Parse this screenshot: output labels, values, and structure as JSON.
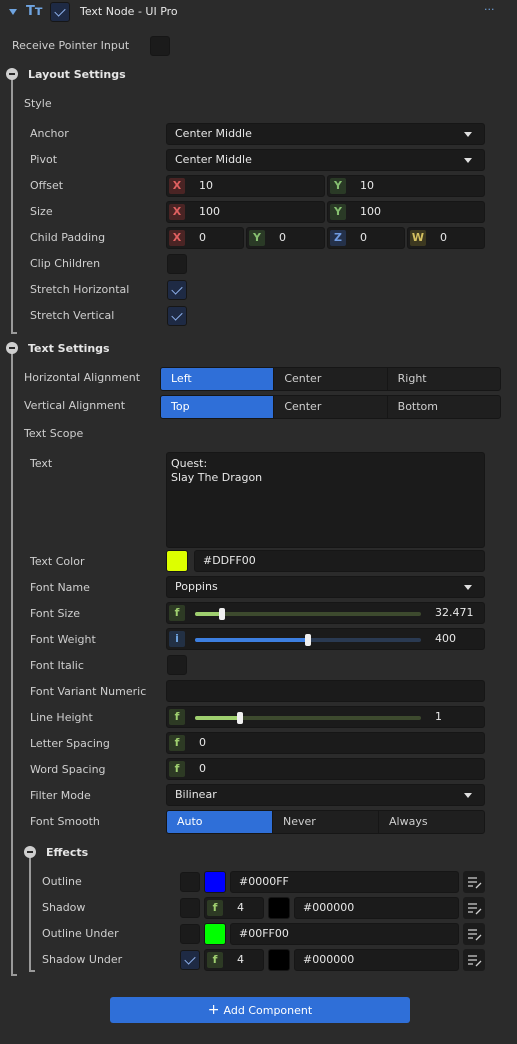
{
  "header": {
    "title": "Text Node - UI Pro",
    "menu": "···"
  },
  "receive_pointer_input": {
    "label": "Receive Pointer Input",
    "checked": false
  },
  "layout": {
    "title": "Layout Settings",
    "style_label": "Style",
    "anchor": {
      "label": "Anchor",
      "value": "Center Middle"
    },
    "pivot": {
      "label": "Pivot",
      "value": "Center Middle"
    },
    "offset": {
      "label": "Offset",
      "x_axis": "X",
      "x": "10",
      "y_axis": "Y",
      "y": "10"
    },
    "size": {
      "label": "Size",
      "x_axis": "X",
      "x": "100",
      "y_axis": "Y",
      "y": "100"
    },
    "child_padding": {
      "label": "Child Padding",
      "x_axis": "X",
      "x": "0",
      "y_axis": "Y",
      "y": "0",
      "z_axis": "Z",
      "z": "0",
      "w_axis": "W",
      "w": "0"
    },
    "clip_children": {
      "label": "Clip Children",
      "checked": false
    },
    "stretch_horizontal": {
      "label": "Stretch Horizontal",
      "checked": true
    },
    "stretch_vertical": {
      "label": "Stretch Vertical",
      "checked": true
    }
  },
  "text_settings": {
    "title": "Text Settings",
    "horizontal_alignment": {
      "label": "Horizontal Alignment",
      "options": [
        "Left",
        "Center",
        "Right"
      ],
      "selected": "Left"
    },
    "vertical_alignment": {
      "label": "Vertical Alignment",
      "options": [
        "Top",
        "Center",
        "Bottom"
      ],
      "selected": "Top"
    },
    "text_scope_label": "Text Scope",
    "text": {
      "label": "Text",
      "value": "Quest:\nSlay The Dragon"
    },
    "text_color": {
      "label": "Text Color",
      "value": "#DDFF00",
      "color": "#DDFF00"
    },
    "font_name": {
      "label": "Font Name",
      "value": "Poppins"
    },
    "font_size": {
      "label": "Font Size",
      "prefix": "f",
      "value": "32.471",
      "fraction": 0.12,
      "track_color": "#9fcf6f"
    },
    "font_weight": {
      "label": "Font Weight",
      "prefix": "i",
      "value": "400",
      "fraction": 0.5,
      "track_color": "#3d7fe0"
    },
    "font_italic": {
      "label": "Font Italic",
      "checked": false
    },
    "font_variant_numeric": {
      "label": "Font Variant Numeric",
      "value": ""
    },
    "line_height": {
      "label": "Line Height",
      "prefix": "f",
      "value": "1",
      "fraction": 0.2,
      "track_color": "#9fcf6f"
    },
    "letter_spacing": {
      "label": "Letter Spacing",
      "prefix": "f",
      "value": "0"
    },
    "word_spacing": {
      "label": "Word Spacing",
      "prefix": "f",
      "value": "0"
    },
    "filter_mode": {
      "label": "Filter Mode",
      "value": "Bilinear"
    },
    "font_smooth": {
      "label": "Font Smooth",
      "options": [
        "Auto",
        "Never",
        "Always"
      ],
      "selected": "Auto"
    }
  },
  "effects": {
    "title": "Effects",
    "outline": {
      "label": "Outline",
      "enabled": false,
      "color": "#0000FF",
      "value": "#0000FF"
    },
    "shadow": {
      "label": "Shadow",
      "enabled": false,
      "prefix": "f",
      "size": "4",
      "color": "#000000",
      "value": "#000000"
    },
    "outline_under": {
      "label": "Outline Under",
      "enabled": false,
      "color": "#00FF00",
      "value": "#00FF00"
    },
    "shadow_under": {
      "label": "Shadow Under",
      "enabled": true,
      "prefix": "f",
      "size": "4",
      "color": "#000000",
      "value": "#000000"
    }
  },
  "add_component": {
    "label": "Add Component",
    "icon": "plus-icon"
  },
  "colors": {
    "accent": "#2f6fd8",
    "panel": "#2b2b2b",
    "field": "#1b1b1b"
  }
}
